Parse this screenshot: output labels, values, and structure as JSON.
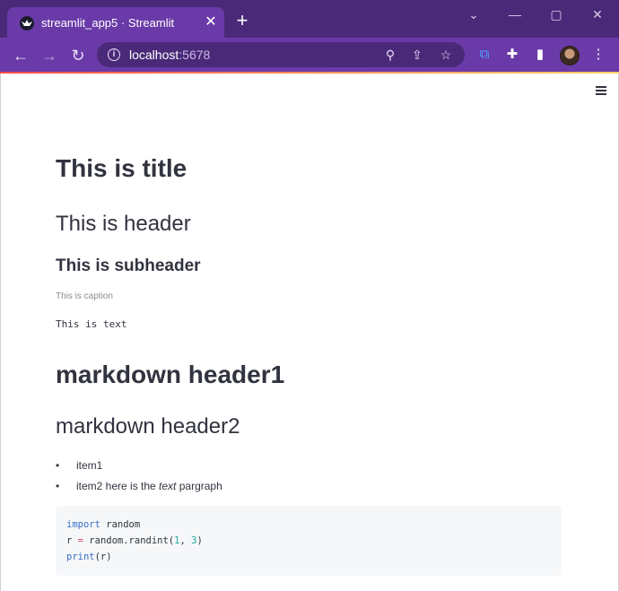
{
  "browser": {
    "tab_title": "streamlit_app5 · Streamlit",
    "tab_close": "✕",
    "new_tab": "+",
    "url_host": "localhost",
    "url_port": ":5678",
    "window_controls": {
      "chevron": "⌄",
      "minimize": "—",
      "maximize": "▢",
      "close": "✕"
    },
    "nav": {
      "back": "←",
      "forward": "→",
      "reload": "↻"
    },
    "icons": {
      "zoom": "⚲",
      "share": "⇪",
      "bookmark": "☆",
      "extension_translate": "⧉",
      "extensions": "✚",
      "sidepanel": "▮",
      "menu": "⋮",
      "info": "i"
    },
    "accent_colors": {
      "frame": "#4a2a78",
      "toolbar": "#6a3aa8",
      "streamlit_bar_start": "#ff4b4b",
      "streamlit_bar_end": "#ffd16a"
    }
  },
  "content": {
    "title": "This is title",
    "header": "This is header",
    "subheader": "This is subheader",
    "caption": "This is caption",
    "text": "This is text",
    "markdown_h1": "markdown header1",
    "markdown_h2": "markdown header2",
    "list": {
      "item1": "item1",
      "item2_prefix": "item2 here is the ",
      "item2_em": "text",
      "item2_suffix": " pargraph"
    },
    "code": {
      "l1_kw": "import",
      "l1_rest": " random",
      "l2_var": "r ",
      "l2_op": "=",
      "l2_call": " random.randint(",
      "l2_a": "1",
      "l2_sep": ", ",
      "l2_b": "3",
      "l2_end": ")",
      "l3_kw": "print",
      "l3_rest": "(r)"
    }
  }
}
